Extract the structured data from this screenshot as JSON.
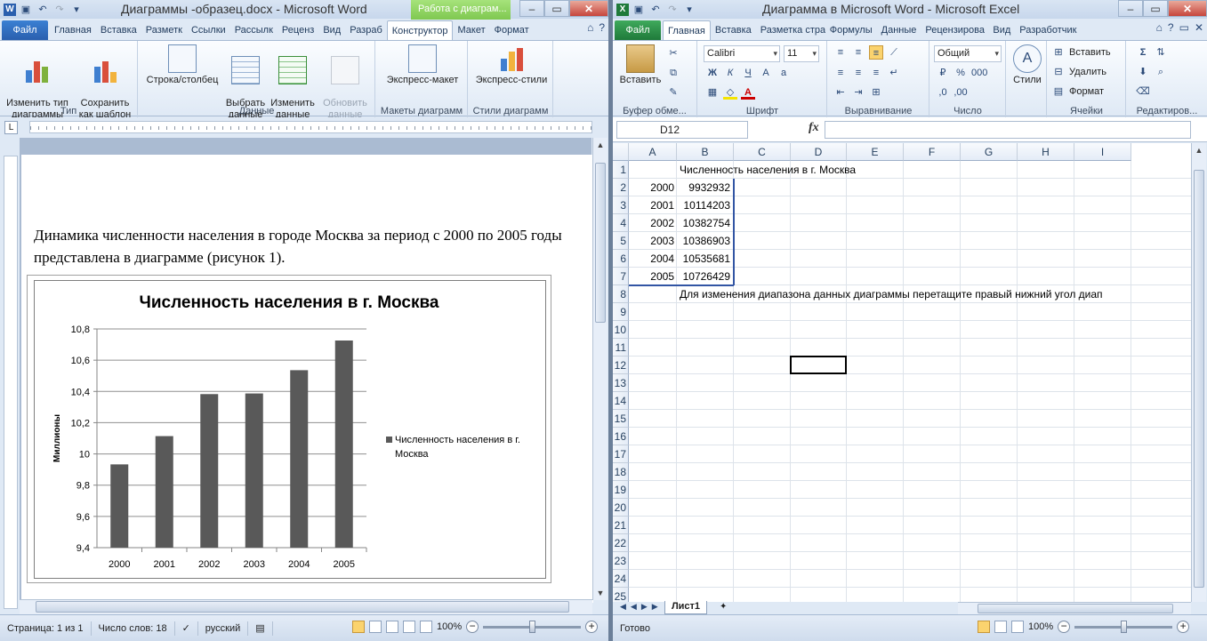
{
  "word": {
    "title": "Диаграммы -образец.docx - Microsoft Word",
    "context_tab": "Работа с диаграм...",
    "tabs": [
      "Файл",
      "Главная",
      "Вставка",
      "Разметк",
      "Ссылки",
      "Рассылк",
      "Реценз",
      "Вид",
      "Разраб",
      "Конструктор",
      "Макет",
      "Формат"
    ],
    "active_tab": "Конструктор",
    "ribbon": {
      "change_type": "Изменить тип\nдиаграммы",
      "save_template": "Сохранить\nкак шаблон",
      "group_type": "Тип",
      "row_col": "Строка/столбец",
      "select_data": "Выбрать\nданные",
      "edit_data": "Изменить\nданные",
      "refresh_data": "Обновить\nданные",
      "group_data": "Данные",
      "quick_layout": "Экспресс-макет",
      "group_layouts": "Макеты диаграмм",
      "quick_styles": "Экспресс-стили",
      "group_styles": "Стили диаграмм"
    },
    "paragraph": "Динамика численности населения в городе Москва за период с 2000 по 2005 годы представлена в диаграмме (рисунок 1).",
    "status": {
      "page": "Страница: 1 из 1",
      "words": "Число слов: 18",
      "language": "русский",
      "zoom": "100%"
    }
  },
  "chart_data": {
    "type": "bar",
    "title": "Численность населения в г. Москва",
    "ylabel": "Миллионы",
    "xlabel": "",
    "categories": [
      "2000",
      "2001",
      "2002",
      "2003",
      "2004",
      "2005"
    ],
    "series": [
      {
        "name": "Численность населения в г. Москва",
        "values": [
          9.933,
          10.114,
          10.383,
          10.387,
          10.536,
          10.726
        ],
        "color": "#595959"
      }
    ],
    "yticks": [
      "9,4",
      "9,6",
      "9,8",
      "10",
      "10,2",
      "10,4",
      "10,6",
      "10,8"
    ],
    "ylim": [
      9.4,
      10.8
    ],
    "grid": true,
    "legend_position": "right",
    "legend_label_lines": [
      "Численность населения в г.",
      "Москва"
    ]
  },
  "excel": {
    "title": "Диаграмма в Microsoft Word  -  Microsoft Excel",
    "tabs": [
      "Файл",
      "Главная",
      "Вставка",
      "Разметка стра",
      "Формулы",
      "Данные",
      "Рецензирова",
      "Вид",
      "Разработчик"
    ],
    "active_tab": "Главная",
    "ribbon": {
      "paste": "Вставить",
      "group_clipboard": "Буфер обме...",
      "font_name": "Calibri",
      "font_size": "11",
      "group_font": "Шрифт",
      "group_align": "Выравнивание",
      "number_format": "Общий",
      "group_number": "Число",
      "styles": "Стили",
      "insert": "Вставить",
      "delete": "Удалить",
      "format": "Формат",
      "group_cells": "Ячейки",
      "group_edit": "Редактиров..."
    },
    "name_box": "D12",
    "fx": "fx",
    "columns": [
      "A",
      "B",
      "C",
      "D",
      "E",
      "F",
      "G",
      "H",
      "I"
    ],
    "rows": [
      "1",
      "2",
      "3",
      "4",
      "5",
      "6",
      "7",
      "8",
      "9",
      "10",
      "11",
      "12",
      "13",
      "14",
      "15",
      "16",
      "17",
      "18",
      "19",
      "20",
      "21",
      "22",
      "23",
      "24",
      "25"
    ],
    "b1": "Численность населения в г. Москва",
    "years": [
      "2000",
      "2001",
      "2002",
      "2003",
      "2004",
      "2005"
    ],
    "values": [
      "9932932",
      "10114203",
      "10382754",
      "10386903",
      "10535681",
      "10726429"
    ],
    "b8": "Для изменения диапазона данных диаграммы перетащите правый нижний угол диап",
    "sheet": "Лист1",
    "status": {
      "ready": "Готово",
      "zoom": "100%"
    }
  }
}
